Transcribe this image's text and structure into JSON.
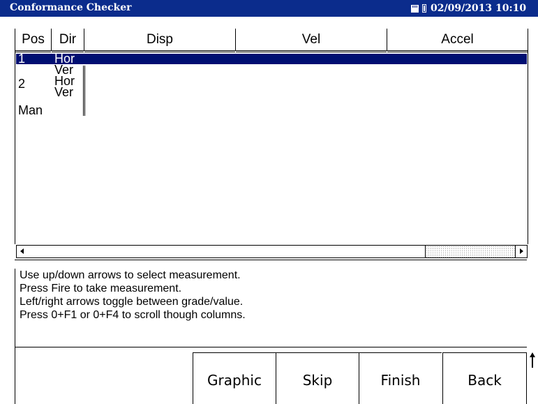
{
  "titlebar": {
    "title": "Conformance Checker",
    "datetime": "02/09/2013 10:10",
    "icons": [
      "sd-card-icon",
      "battery-icon"
    ]
  },
  "table": {
    "columns": [
      "Pos",
      "Dir",
      "Disp",
      "Vel",
      "Accel"
    ],
    "rows": [
      {
        "pos": "1",
        "dir": "Hor",
        "selected": true
      },
      {
        "pos": "",
        "dir": "Ver",
        "selected": false
      },
      {
        "pos": "2",
        "dir": "Hor",
        "selected": false
      },
      {
        "pos": "",
        "dir": "Ver",
        "selected": false
      },
      {
        "pos": "Man",
        "dir": "",
        "selected": false
      }
    ]
  },
  "instructions": [
    "Use up/down arrows to select measurement.",
    "Press Fire to take measurement.",
    "Left/right arrows toggle between grade/value.",
    "Press 0+F1 or 0+F4 to scroll though columns."
  ],
  "softkeys": {
    "graphic": "Graphic",
    "skip": "Skip",
    "finish": "Finish",
    "back": "Back"
  },
  "colors": {
    "titlebar": "#0b2c8c",
    "selection": "#000f72"
  }
}
